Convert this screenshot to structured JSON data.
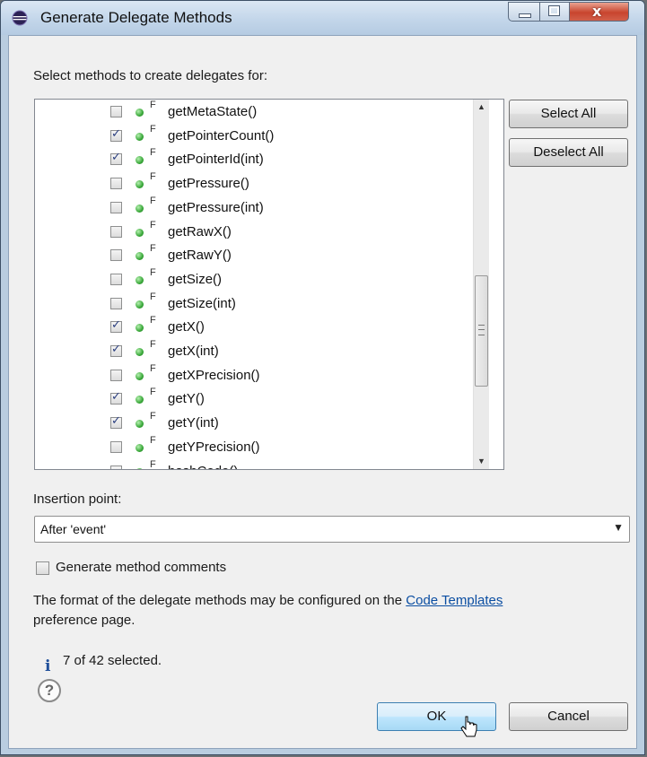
{
  "window": {
    "title": "Generate Delegate Methods",
    "app_icon": "eclipse-icon"
  },
  "list": {
    "label": "Select methods to create delegates for:",
    "items": [
      {
        "name": "getMetaState()",
        "checked": false
      },
      {
        "name": "getPointerCount()",
        "checked": true
      },
      {
        "name": "getPointerId(int)",
        "checked": true
      },
      {
        "name": "getPressure()",
        "checked": false
      },
      {
        "name": "getPressure(int)",
        "checked": false
      },
      {
        "name": "getRawX()",
        "checked": false
      },
      {
        "name": "getRawY()",
        "checked": false
      },
      {
        "name": "getSize()",
        "checked": false
      },
      {
        "name": "getSize(int)",
        "checked": false
      },
      {
        "name": "getX()",
        "checked": true
      },
      {
        "name": "getX(int)",
        "checked": true
      },
      {
        "name": "getXPrecision()",
        "checked": false
      },
      {
        "name": "getY()",
        "checked": true
      },
      {
        "name": "getY(int)",
        "checked": true
      },
      {
        "name": "getYPrecision()",
        "checked": false
      },
      {
        "name": "hashCode()",
        "checked": false
      }
    ],
    "final_marker": "F"
  },
  "buttons": {
    "select_all": "Select All",
    "deselect_all": "Deselect All",
    "ok": "OK",
    "cancel": "Cancel"
  },
  "insertion": {
    "label": "Insertion point:",
    "value": "After 'event'"
  },
  "comments": {
    "label": "Generate method comments",
    "checked": false
  },
  "format_note": {
    "text_before": "The format of the delegate methods may be configured on the ",
    "link": "Code Templates",
    "text_after": "preference page."
  },
  "status": {
    "text": "7 of 42 selected."
  },
  "colors": {
    "link": "#0b4ea2",
    "method_dot": "#3aa83a",
    "default_button": "#bee6fd"
  }
}
